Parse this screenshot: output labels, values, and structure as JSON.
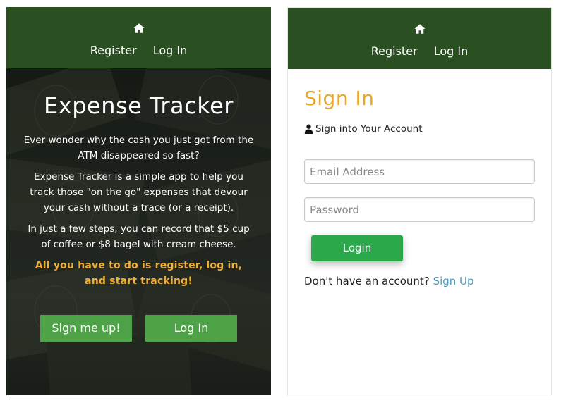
{
  "left": {
    "nav": {
      "home_icon": "home-icon",
      "register": "Register",
      "login": "Log In"
    },
    "hero": {
      "title": "Expense Tracker",
      "paragraph1": "Ever wonder why the cash you just got from the ATM disappeared so fast?",
      "paragraph2": "Expense Tracker is a simple app to help you track those \"on the go\" expenses that devour your cash without a trace (or a receipt).",
      "paragraph3": "In just a few steps, you can record that $5 cup of coffee or $8 bagel with cream cheese.",
      "cta": "All you have to do is register, log in, and start tracking!",
      "signup_button": "Sign me up!",
      "login_button": "Log In"
    }
  },
  "right": {
    "nav": {
      "home_icon": "home-icon",
      "register": "Register",
      "login": "Log In"
    },
    "signin": {
      "title": "Sign In",
      "user_icon": "user-icon",
      "subtitle": "Sign into Your Account",
      "email_placeholder": "Email Address",
      "password_placeholder": "Password",
      "login_button": "Login",
      "no_account_text": "Don't have an account?",
      "signup_link": "Sign Up"
    }
  },
  "colors": {
    "navbar": "#2a5022",
    "accent_orange": "#e8a82e",
    "hero_button": "#4ea248",
    "login_button": "#2aa84a",
    "link": "#4a9bc0"
  }
}
